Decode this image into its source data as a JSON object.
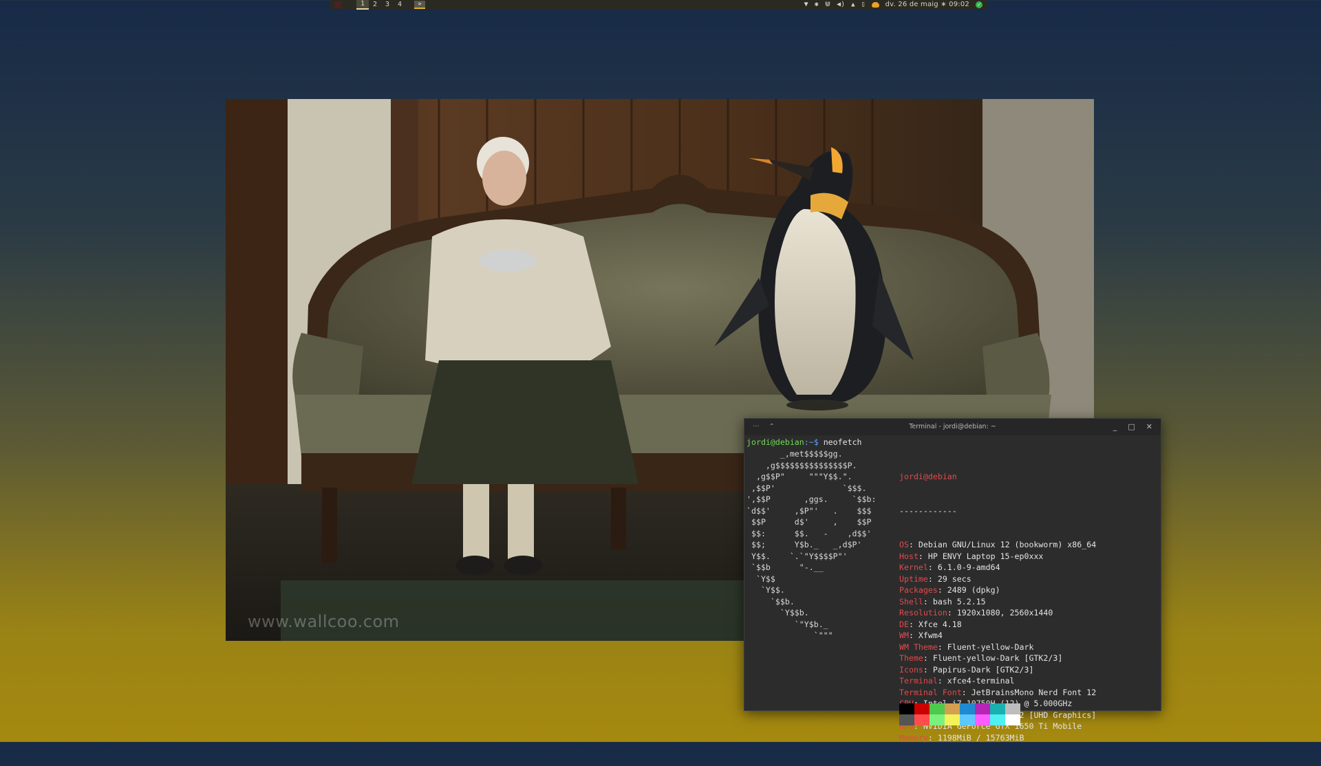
{
  "panel": {
    "workspaces": [
      "1",
      "2",
      "3",
      "4"
    ],
    "active_workspace": "1",
    "app_button_icon": "terminal-icon",
    "tray_icons": [
      "network-icon",
      "bluetooth-icon",
      "usb-icon",
      "volume-icon",
      "notification-bell-icon",
      "battery-icon",
      "weather-icon"
    ],
    "clock": "dv. 26 de maig ∗ 09:02",
    "update_icon": "update-icon"
  },
  "wallpaper": {
    "watermark": "www.wallcoo.com"
  },
  "terminal": {
    "title": "Terminal - jordi@debian: ~",
    "titlebar_left_icons": [
      "menu-dots-icon",
      "roll-up-icon"
    ],
    "controls": [
      "minimize-icon",
      "maximize-icon",
      "close-icon"
    ],
    "prompt_user": "jordi@debian",
    "prompt_path": ":~$",
    "command": " neofetch",
    "logo_lines": [
      "       _,met$$$$$gg.",
      "    ,g$$$$$$$$$$$$$$$P.",
      "  ,g$$P\"     \"\"\"Y$$.\".",
      " ,$$P'              `$$$.",
      "',$$P       ,ggs.     `$$b:",
      "`d$$'     ,$P\"'   .    $$$",
      " $$P      d$'     ,    $$P",
      " $$:      $$.   -    ,d$$'",
      " $$;      Y$b._   _,d$P'",
      " Y$$.    `.`\"Y$$$$P\"'",
      " `$$b      \"-.__",
      "  `Y$$",
      "   `Y$$.",
      "     `$$b.",
      "       `Y$$b.",
      "          `\"Y$b._",
      "              `\"\"\""
    ],
    "info_header_user": "jordi@debian",
    "info_separator": "------------",
    "info": [
      {
        "key": "OS",
        "value": ": Debian GNU/Linux 12 (bookworm) x86_64"
      },
      {
        "key": "Host",
        "value": ": HP ENVY Laptop 15-ep0xxx"
      },
      {
        "key": "Kernel",
        "value": ": 6.1.0-9-amd64"
      },
      {
        "key": "Uptime",
        "value": ": 29 secs"
      },
      {
        "key": "Packages",
        "value": ": 2489 (dpkg)"
      },
      {
        "key": "Shell",
        "value": ": bash 5.2.15"
      },
      {
        "key": "Resolution",
        "value": ": 1920x1080, 2560x1440"
      },
      {
        "key": "DE",
        "value": ": Xfce 4.18"
      },
      {
        "key": "WM",
        "value": ": Xfwm4"
      },
      {
        "key": "WM Theme",
        "value": ": Fluent-yellow-Dark"
      },
      {
        "key": "Theme",
        "value": ": Fluent-yellow-Dark [GTK2/3]"
      },
      {
        "key": "Icons",
        "value": ": Papirus-Dark [GTK2/3]"
      },
      {
        "key": "Terminal",
        "value": ": xfce4-terminal"
      },
      {
        "key": "Terminal Font",
        "value": ": JetBrainsMono Nerd Font 12"
      },
      {
        "key": "CPU",
        "value": ": Intel i7-10750H (12) @ 5.000GHz"
      },
      {
        "key": "GPU",
        "value": ": Intel CometLake-H GT2 [UHD Graphics]"
      },
      {
        "key": "GPU",
        "value": ": NVIDIA GeForce GTX 1650 Ti Mobile"
      },
      {
        "key": "Memory",
        "value": ": 1198MiB / 15763MiB"
      }
    ],
    "palette_row1": [
      "#000000",
      "#cc0000",
      "#4ec94e",
      "#d4a050",
      "#1f8ad1",
      "#b526b5",
      "#1ab0b0",
      "#bdbdbd"
    ],
    "palette_row2": [
      "#555555",
      "#ff4d4d",
      "#7cf07c",
      "#f2f25a",
      "#5cc8ff",
      "#ff5cff",
      "#4ff0f0",
      "#ffffff"
    ]
  }
}
